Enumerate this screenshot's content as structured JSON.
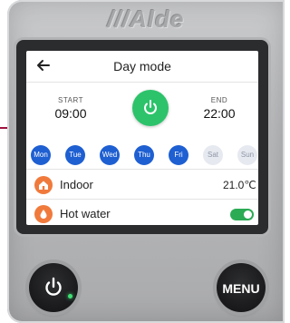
{
  "device": {
    "brand": "///Alde",
    "led_color": "#3fe074"
  },
  "screen": {
    "title": "Day mode",
    "back_icon": "arrow-left-icon",
    "start": {
      "label": "START",
      "time": "09:00"
    },
    "end": {
      "label": "END",
      "time": "22:00"
    },
    "power_icon": "power-icon",
    "power_color": "#2cc36b",
    "days": [
      {
        "label": "Mon",
        "active": true
      },
      {
        "label": "Tue",
        "active": true
      },
      {
        "label": "Wed",
        "active": true
      },
      {
        "label": "Thu",
        "active": true
      },
      {
        "label": "Fri",
        "active": true
      },
      {
        "label": "Sat",
        "active": false
      },
      {
        "label": "Sun",
        "active": false
      }
    ],
    "indoor": {
      "label": "Indoor",
      "value": "21.0℃",
      "icon": "house-icon"
    },
    "hot_water": {
      "label": "Hot water",
      "enabled": true,
      "icon": "droplet-icon"
    },
    "accent_blue": "#1e5fd2",
    "accent_orange": "#f07a3c"
  },
  "buttons": {
    "power_icon": "power-icon",
    "menu_label": "MENU"
  }
}
